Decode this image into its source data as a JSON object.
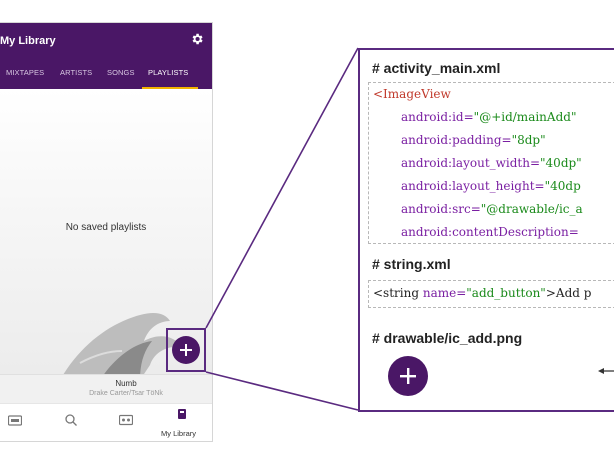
{
  "phone": {
    "app_title": "My Library",
    "tabs": [
      "MIXTAPES",
      "ARTISTS",
      "SONGS",
      "PLAYLISTS"
    ],
    "active_tab": "PLAYLISTS",
    "empty_message": "No saved playlists",
    "now_playing": {
      "track": "Numb",
      "artist": "Drake Carter/Tsar TöNk"
    },
    "bottom_nav": {
      "library_label": "My Library"
    },
    "colors": {
      "primary": "#4a1766",
      "tab_indicator": "#f2b400"
    }
  },
  "code_panel": {
    "activity_heading": "# activity_main.xml",
    "activity_lines": {
      "tag": "<ImageView",
      "l1": {
        "attr": "android:id=",
        "val": "\"@+id/mainAdd\""
      },
      "l2": {
        "attr": "android:padding=",
        "val": "\"8dp\""
      },
      "l3": {
        "attr": "android:layout_width=",
        "val": "\"40dp\""
      },
      "l4": {
        "attr": "android:layout_height=",
        "val": "\"40dp"
      },
      "l5": {
        "attr": "android:src=",
        "val": "\"@drawable/ic_a"
      },
      "l6": {
        "attr": "android:contentDescription=",
        "val": ""
      }
    },
    "string_heading": "# string.xml",
    "string_line": {
      "open": "<string ",
      "name_attr": "name=",
      "name_val": "\"add_button\"",
      "text": ">Add p"
    },
    "drawable_heading": "# drawable/ic_add.png",
    "colors": {
      "border": "#5a2a80",
      "tag": "#c0392b",
      "attr": "#7a1fa2",
      "value": "#1a8a1a"
    }
  }
}
